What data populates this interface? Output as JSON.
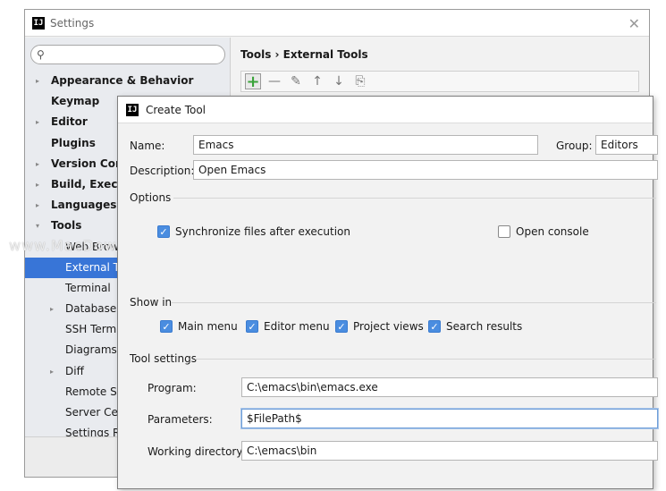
{
  "window": {
    "title": "Settings"
  },
  "search": {
    "placeholder": ""
  },
  "sidebar": {
    "items": [
      {
        "label": "Appearance & Behavior",
        "indent": 0,
        "arrow": "▸",
        "bold": true
      },
      {
        "label": "Keymap",
        "indent": 0,
        "arrow": "",
        "bold": true
      },
      {
        "label": "Editor",
        "indent": 0,
        "arrow": "▸",
        "bold": true
      },
      {
        "label": "Plugins",
        "indent": 0,
        "arrow": "",
        "bold": true
      },
      {
        "label": "Version Control",
        "indent": 0,
        "arrow": "▸",
        "bold": true
      },
      {
        "label": "Build, Execution, Deployment",
        "indent": 0,
        "arrow": "▸",
        "bold": true
      },
      {
        "label": "Languages & Frameworks",
        "indent": 0,
        "arrow": "▸",
        "bold": true
      },
      {
        "label": "Tools",
        "indent": 0,
        "arrow": "▾",
        "bold": true
      },
      {
        "label": "Web Browsers",
        "indent": 1,
        "arrow": "",
        "bold": false
      },
      {
        "label": "External Tools",
        "indent": 1,
        "arrow": "",
        "bold": false,
        "selected": true
      },
      {
        "label": "Terminal",
        "indent": 1,
        "arrow": "",
        "bold": false
      },
      {
        "label": "Database",
        "indent": 1,
        "arrow": "▸",
        "bold": false
      },
      {
        "label": "SSH Terminal",
        "indent": 1,
        "arrow": "",
        "bold": false
      },
      {
        "label": "Diagrams",
        "indent": 1,
        "arrow": "",
        "bold": false
      },
      {
        "label": "Diff",
        "indent": 1,
        "arrow": "▸",
        "bold": false
      },
      {
        "label": "Remote SSH External Tools",
        "indent": 1,
        "arrow": "",
        "bold": false
      },
      {
        "label": "Server Certificates",
        "indent": 1,
        "arrow": "",
        "bold": false
      },
      {
        "label": "Settings Repository",
        "indent": 1,
        "arrow": "",
        "bold": false
      }
    ]
  },
  "main": {
    "breadcrumb": "Tools › External Tools"
  },
  "toolbar": {
    "add_icon": "plus-icon",
    "remove_icon": "minus-icon",
    "edit_icon": "pencil-icon",
    "up_icon": "arrow-up-icon",
    "down_icon": "arrow-down-icon",
    "copy_icon": "copy-icon"
  },
  "dialog": {
    "title": "Create Tool",
    "name_label": "Name:",
    "name_value": "Emacs",
    "group_label": "Group:",
    "group_value": "Editors",
    "description_label": "Description:",
    "description_value": "Open Emacs",
    "options_heading": "Options",
    "sync_label": "Synchronize files after execution",
    "sync_checked": true,
    "console_label": "Open console",
    "console_checked": false,
    "show_in_heading": "Show in",
    "main_menu_label": "Main menu",
    "editor_menu_label": "Editor menu",
    "project_views_label": "Project views",
    "search_results_label": "Search results",
    "tool_settings_heading": "Tool settings",
    "program_label": "Program:",
    "program_value": "C:\\emacs\\bin\\emacs.exe",
    "parameters_label": "Parameters:",
    "parameters_value": "$FilePath$",
    "workdir_label": "Working directory:",
    "workdir_value": "C:\\emacs\\bin"
  },
  "watermark": "www.MacDown.com",
  "colors": {
    "selection": "#3875d7",
    "checkbox": "#4a8de0",
    "add": "#3aa33a"
  }
}
